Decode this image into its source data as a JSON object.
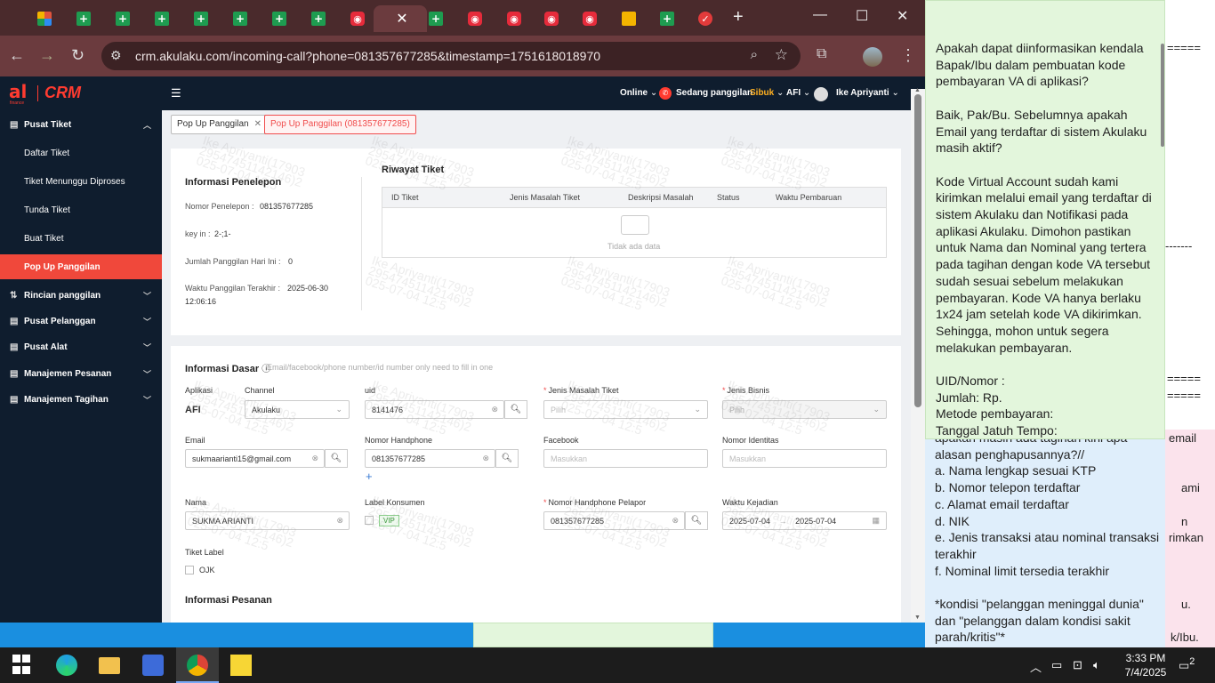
{
  "browser": {
    "url": "crm.akulaku.com/incoming-call?phone=081357677285&timestamp=1751618018970"
  },
  "crm": {
    "logo_text": "CRM",
    "logo_al": "al",
    "logo_sub": "finance",
    "header": {
      "online": "Online",
      "in_call": "Sedang panggilan",
      "busy": "Sibuk",
      "company": "AFI",
      "user": "Ike Apriyanti"
    },
    "sidebar": {
      "items": [
        {
          "label": "Pusat Tiket"
        },
        {
          "label": "Daftar Tiket"
        },
        {
          "label": "Tiket Menunggu Diproses"
        },
        {
          "label": "Tunda Tiket"
        },
        {
          "label": "Buat Tiket"
        },
        {
          "label": "Pop Up Panggilan"
        },
        {
          "label": "Rincian panggilan"
        },
        {
          "label": "Pusat Pelanggan"
        },
        {
          "label": "Pusat Alat"
        },
        {
          "label": "Manajemen Pesanan"
        },
        {
          "label": "Manajemen Tagihan"
        }
      ]
    },
    "tabs": [
      {
        "label": "Pop Up Panggilan"
      },
      {
        "label": "Pop Up Panggilan (081357677285)"
      }
    ],
    "caller": {
      "title": "Informasi Penelepon",
      "phone_label": "Nomor Penelepon :",
      "phone": "081357677285",
      "keyin_label": "key in :",
      "keyin": "2-;1-",
      "count_label": "Jumlah Panggilan Hari Ini :",
      "count": "0",
      "last_label": "Waktu Panggilan Terakhir :",
      "last_date": "2025-06-30",
      "last_time": "12:06:16"
    },
    "history": {
      "title": "Riwayat Tiket",
      "columns": [
        "ID Tiket",
        "Jenis Masalah Tiket",
        "Deskripsi Masalah",
        "Status",
        "Waktu Pembaruan"
      ],
      "empty": "Tidak ada data"
    },
    "basic": {
      "title": "Informasi Dasar",
      "hint": "Email/facebook/phone number/id number only need to fill in one",
      "aplikasi_label": "Aplikasi",
      "aplikasi": "AFI",
      "channel_label": "Channel",
      "channel": "Akulaku",
      "uid_label": "uid",
      "uid": "8141476",
      "jenis_masalah_label": "Jenis Masalah Tiket",
      "jenis_bisnis_label": "Jenis Bisnis",
      "pilih": "Pilih",
      "email_label": "Email",
      "email": "sukmaarianti15@gmail.com",
      "hp_label": "Nomor Handphone",
      "hp": "081357677285",
      "facebook_label": "Facebook",
      "identitas_label": "Nomor Identitas",
      "masukkan": "Masukkan",
      "nama_label": "Nama",
      "nama": "SUKMA ARIANTI",
      "label_konsumen": "Label Konsumen",
      "vip": "VIP",
      "hp_pelapor_label": "Nomor Handphone Pelapor",
      "hp_pelapor": "081357677285",
      "waktu_label": "Waktu Kejadian",
      "date_from": "2025-07-04",
      "date_to": "2025-07-04",
      "tiket_label": "Tiket Label",
      "ojk": "OJK",
      "pesanan_title": "Informasi Pesanan"
    },
    "watermark": "Ike Apriyanti(17903\n29547451142146)2\n025-07-04 12:5"
  },
  "notes": {
    "green": "Apakah dapat diinformasikan kendala Bapak/Ibu dalam pembuatan kode pembayaran VA di aplikasi?\n\nBaik, Pak/Bu. Sebelumnya apakah Email yang terdaftar di sistem Akulaku masih aktif?\n\nKode Virtual Account sudah kami kirimkan melalui email yang terdaftar di sistem Akulaku dan Notifikasi pada aplikasi Akulaku. Dimohon pastikan untuk Nama dan Nominal yang tertera pada tagihan dengan kode VA tersebut sudah sesuai sebelum melakukan pembayaran. Kode VA hanya berlaku 1x24 jam setelah kode VA dikirimkan. Sehingga, mohon untuk segera melakukan pembayaran.\n\nUID/Nomor :\nJumlah: Rp.\nMetode pembayaran:\nTanggal Jatuh Tempo:",
    "blue": "apakah masih ada tagihan kini apa\nalasan penghapusannya?//\na. Nama lengkap sesuai KTP\nb. Nomor telepon terdaftar\nc. Alamat email terdaftar\nd. NIK\ne. Jenis transaksi atau nominal transaksi terakhir\nf. Nominal limit tersedia terakhir\n\n*kondisi \"pelanggan meninggal dunia\" dan \"pelanggan dalam kondisi sakit parah/kritis\"*",
    "bg_fragments": [
      "=====",
      "-------",
      "=====",
      "=====",
      "email",
      "ami",
      "n",
      "rimkan",
      "u.",
      "k/Ibu."
    ]
  },
  "taskbar": {
    "time": "3:33 PM",
    "date": "7/4/2025",
    "notif_count": "2"
  }
}
